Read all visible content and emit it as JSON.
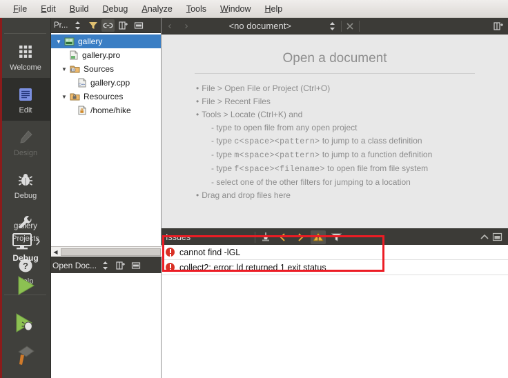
{
  "menubar": {
    "items": [
      {
        "pre": "",
        "accel": "F",
        "post": "ile"
      },
      {
        "pre": "",
        "accel": "E",
        "post": "dit"
      },
      {
        "pre": "",
        "accel": "B",
        "post": "uild"
      },
      {
        "pre": "",
        "accel": "D",
        "post": "ebug"
      },
      {
        "pre": "",
        "accel": "A",
        "post": "nalyze"
      },
      {
        "pre": "",
        "accel": "T",
        "post": "ools"
      },
      {
        "pre": "",
        "accel": "W",
        "post": "indow"
      },
      {
        "pre": "",
        "accel": "H",
        "post": "elp"
      }
    ]
  },
  "modebar": {
    "modes": [
      {
        "label": "Welcome",
        "icon": "grid-icon",
        "state": "normal"
      },
      {
        "label": "Edit",
        "icon": "document-icon",
        "state": "selected"
      },
      {
        "label": "Design",
        "icon": "pencil-icon",
        "state": "disabled"
      },
      {
        "label": "Debug",
        "icon": "bug-icon",
        "state": "normal"
      },
      {
        "label": "Projects",
        "icon": "wrench-icon",
        "state": "normal"
      },
      {
        "label": "Help",
        "icon": "question-icon",
        "state": "normal"
      }
    ],
    "kit": {
      "project_name": "gallery",
      "target_icon": "desktop-icon",
      "build_config": "Debug",
      "run_icon": "play-icon",
      "debug_icon": "play-bug-icon",
      "build_icon": "hammer-icon"
    }
  },
  "project_panel": {
    "selector_label": "Pr...",
    "toolbar": [
      {
        "name": "updown-arrows-icon"
      },
      {
        "name": "filter-icon"
      },
      {
        "name": "link-icon"
      },
      {
        "name": "split-icon"
      },
      {
        "name": "dock-icon"
      }
    ],
    "tree": [
      {
        "label": "gallery",
        "indent": 0,
        "twisty": "down",
        "icon": "project-icon",
        "selected": true
      },
      {
        "label": "gallery.pro",
        "indent": 1,
        "twisty": "none",
        "icon": "pro-file-icon",
        "selected": false
      },
      {
        "label": "Sources",
        "indent": 1,
        "twisty": "down",
        "icon": "sources-folder-icon",
        "selected": false
      },
      {
        "label": "gallery.cpp",
        "indent": 2,
        "twisty": "none",
        "icon": "cpp-file-icon",
        "selected": false
      },
      {
        "label": "Resources",
        "indent": 1,
        "twisty": "down",
        "icon": "resources-folder-icon",
        "selected": false
      },
      {
        "label": "/home/hike",
        "indent": 2,
        "twisty": "none",
        "icon": "resource-file-icon",
        "selected": false
      }
    ]
  },
  "open_documents": {
    "selector_label": "Open Doc...",
    "items": []
  },
  "editor": {
    "toolbar": {
      "back_icon": "chevron-left-icon",
      "forward_icon": "chevron-right-icon",
      "document_title": "<no document>",
      "updown_icon": "updown-arrows-icon",
      "close_icon": "close-icon",
      "split_icon": "split-icon"
    },
    "placeholder": {
      "title": "Open a document",
      "lines": [
        {
          "text": "File > Open File or Project (Ctrl+O)",
          "level": 0,
          "mono": null
        },
        {
          "text": "File > Recent Files",
          "level": 0,
          "mono": null
        },
        {
          "text": "Tools > Locate (Ctrl+K) and",
          "level": 0,
          "mono": null
        },
        {
          "text": "- type to open file from any open project",
          "level": 1,
          "mono": null
        },
        {
          "pre": "- type ",
          "mono": "c<space><pattern>",
          "post": " to jump to a class definition",
          "level": 1
        },
        {
          "pre": "- type ",
          "mono": "m<space><pattern>",
          "post": " to jump to a function definition",
          "level": 1
        },
        {
          "pre": "- type ",
          "mono": "f<space><filename>",
          "post": " to open file from file system",
          "level": 1
        },
        {
          "text": "- select one of the other filters for jumping to a location",
          "level": 1,
          "mono": null
        },
        {
          "text": "Drag and drop files here",
          "level": 0,
          "mono": null
        }
      ],
      "bullet": "•"
    }
  },
  "output_pane": {
    "title": "Issues",
    "toolbar": [
      {
        "name": "clear-icon"
      },
      {
        "name": "prev-issue-icon"
      },
      {
        "name": "next-issue-icon"
      },
      {
        "name": "warning-filter-icon",
        "active": true
      },
      {
        "name": "filter-funnel-icon"
      }
    ],
    "right_buttons": [
      {
        "name": "collapse-icon"
      },
      {
        "name": "maximize-icon"
      }
    ],
    "issues": [
      {
        "severity": "error",
        "message": "cannot find -lGL"
      },
      {
        "severity": "error",
        "message": "collect2: error: ld returned 1 exit status"
      }
    ]
  },
  "annotation": {
    "color": "#ec1c24",
    "shape": "rectangle"
  },
  "colors": {
    "chrome": "#3c3b37",
    "selection_blue": "#3a7ec4",
    "error_red": "#d93025",
    "accent_red": "#8b1b1b"
  }
}
